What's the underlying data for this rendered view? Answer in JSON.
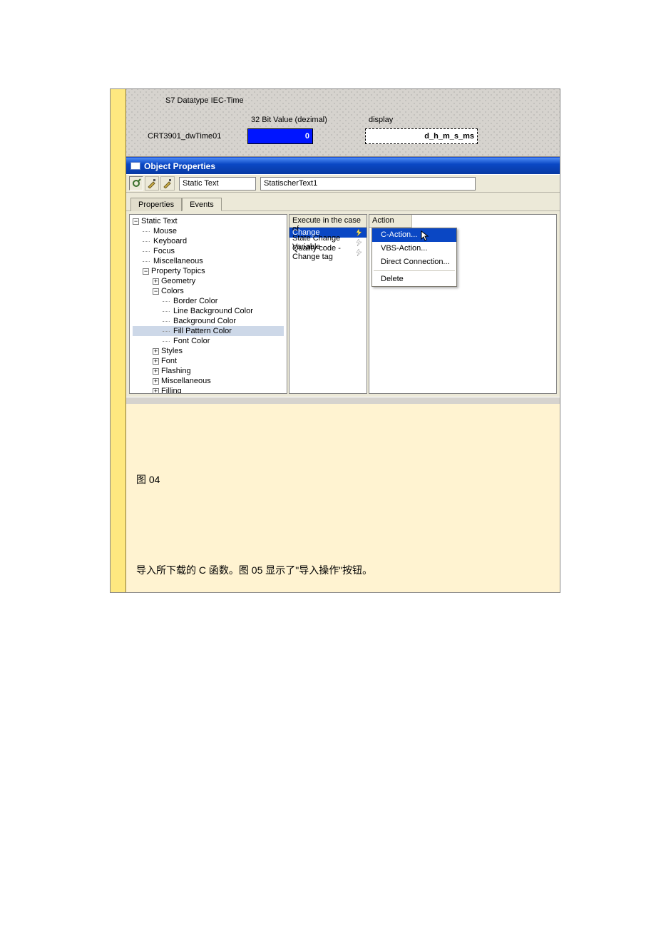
{
  "canvas": {
    "s7_label": "S7 Datatype IEC-Time",
    "bit_label": "32 Bit Value (dezimal)",
    "display_label": "display",
    "crt_label": "CRT3901_dwTime01",
    "io_value": "0",
    "io_text": "d_h_m_s_ms"
  },
  "titlebar": {
    "title": "Object Properties"
  },
  "toolbar": {
    "field1": "Static Text",
    "field2": "StatischerText1"
  },
  "tabs": {
    "properties": "Properties",
    "events": "Events"
  },
  "tree": {
    "root": "Static Text",
    "mouse": "Mouse",
    "keyboard": "Keyboard",
    "focus": "Focus",
    "misc": "Miscellaneous",
    "prop_topics": "Property Topics",
    "geometry": "Geometry",
    "colors": "Colors",
    "border_color": "Border Color",
    "line_bg": "Line Background Color",
    "bg_color": "Background Color",
    "fill_pattern": "Fill Pattern Color",
    "font_color": "Font Color",
    "styles": "Styles",
    "font": "Font",
    "flashing": "Flashing",
    "misc2": "Miscellaneous",
    "filling": "Filling"
  },
  "list": {
    "header": "Execute in the case of",
    "change": "Change",
    "state_change": "State Change Variable",
    "quality": "Quality code - Change tag"
  },
  "action": {
    "header": "Action",
    "c_action": "C-Action...",
    "vbs_action": "VBS-Action...",
    "direct": "Direct Connection...",
    "delete": "Delete"
  },
  "doc": {
    "caption": "图  04",
    "paragraph": "导入所下载的 C 函数。图 05 显示了\"导入操作\"按钮。"
  }
}
